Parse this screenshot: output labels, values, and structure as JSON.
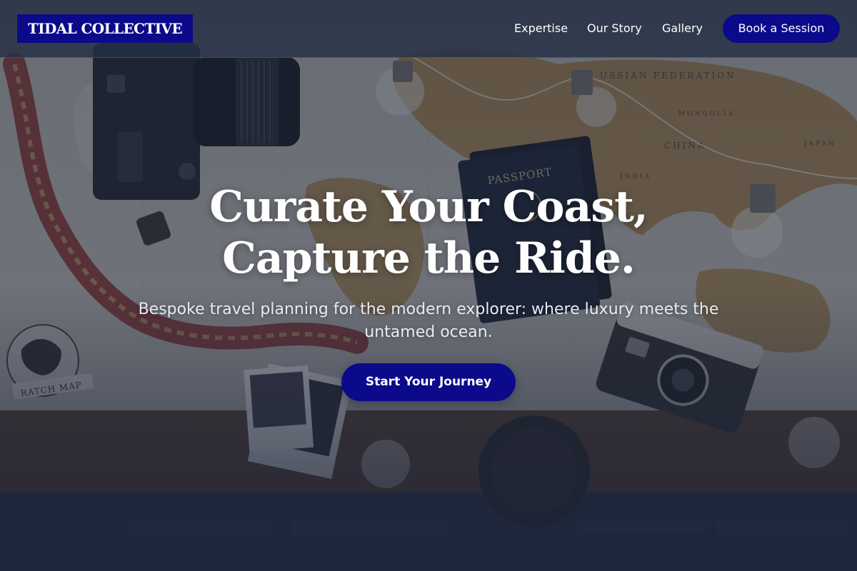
{
  "header": {
    "logo_text": "TIDAL COLLECTIVE",
    "nav": [
      {
        "label": "Expertise"
      },
      {
        "label": "Our Story"
      },
      {
        "label": "Gallery"
      }
    ],
    "cta_label": "Book a Session"
  },
  "hero": {
    "title_line1": "Curate Your Coast,",
    "title_line2": "Capture the Ride.",
    "subtitle": "Bespoke travel planning for the modern explorer: where luxury meets the untamed ocean.",
    "cta_label": "Start Your Journey",
    "background_labels": {
      "passport": "PASSPORT",
      "russian_federation": "RUSSIAN FEDERATION",
      "china": "CHINA",
      "mongolia": "MONGOLIA",
      "india": "INDIA",
      "japan": "JAPAN",
      "scratch_map": "RATCH MAP"
    }
  },
  "colors": {
    "brand": "#0a0a8a",
    "header_bg": "#252f44",
    "overlay": "#1e283e",
    "text": "#ffffff"
  }
}
